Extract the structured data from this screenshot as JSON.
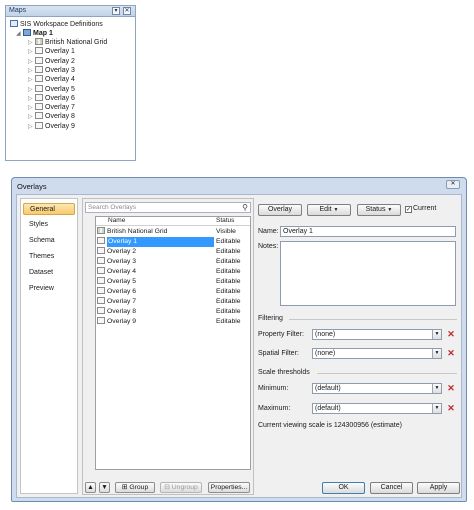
{
  "maps_panel": {
    "title": "Maps",
    "pin_glyph": "▾",
    "close_glyph": "✕",
    "root_label": "SIS Workspace Definitions",
    "map_label": "Map 1",
    "items": [
      {
        "label": "British National Grid",
        "icon": "grid-icon"
      },
      {
        "label": "Overlay 1",
        "icon": "overlay-icon"
      },
      {
        "label": "Overlay 2",
        "icon": "overlay-icon"
      },
      {
        "label": "Overlay 3",
        "icon": "overlay-icon"
      },
      {
        "label": "Overlay 4",
        "icon": "overlay-icon"
      },
      {
        "label": "Overlay 5",
        "icon": "overlay-icon"
      },
      {
        "label": "Overlay 6",
        "icon": "overlay-icon"
      },
      {
        "label": "Overlay 7",
        "icon": "overlay-icon"
      },
      {
        "label": "Overlay 8",
        "icon": "overlay-icon"
      },
      {
        "label": "Overlay 9",
        "icon": "overlay-icon"
      }
    ]
  },
  "dialog": {
    "title": "Overlays",
    "close_glyph": "✕",
    "nav": [
      "General",
      "Styles",
      "Schema",
      "Themes",
      "Dataset",
      "Preview"
    ],
    "nav_selected": "General",
    "search_placeholder": "Search Overlays",
    "search_icon": "🔍",
    "columns": {
      "name": "Name",
      "status": "Status"
    },
    "rows": [
      {
        "name": "British National Grid",
        "status": "Visible"
      },
      {
        "name": "Overlay 1",
        "status": "Editable"
      },
      {
        "name": "Overlay 2",
        "status": "Editable"
      },
      {
        "name": "Overlay 3",
        "status": "Editable"
      },
      {
        "name": "Overlay 4",
        "status": "Editable"
      },
      {
        "name": "Overlay 5",
        "status": "Editable"
      },
      {
        "name": "Overlay 6",
        "status": "Editable"
      },
      {
        "name": "Overlay 7",
        "status": "Editable"
      },
      {
        "name": "Overlay 8",
        "status": "Editable"
      },
      {
        "name": "Overlay 9",
        "status": "Editable"
      }
    ],
    "selected_row": "Overlay 1",
    "list_buttons": {
      "up": "▲",
      "down": "▼",
      "group": "Group",
      "ungroup": "Ungroup",
      "properties": "Properties..."
    },
    "toolbar": {
      "overlay": "Overlay",
      "edit": "Edit",
      "status": "Status",
      "current": "Current",
      "current_checked": "✓",
      "arrow": "▼"
    },
    "name_label": "Name:",
    "name_value": "Overlay 1",
    "notes_label": "Notes:",
    "filtering_label": "Filtering",
    "property_filter_label": "Property Filter:",
    "property_filter_value": "(none)",
    "spatial_filter_label": "Spatial Filter:",
    "spatial_filter_value": "(none)",
    "scale_label": "Scale thresholds",
    "minimum_label": "Minimum:",
    "minimum_value": "(default)",
    "maximum_label": "Maximum:",
    "maximum_value": "(default)",
    "scale_text": "Current viewing scale is 124300956 (estimate)",
    "clear_glyph": "✕",
    "ok": "OK",
    "cancel": "Cancel",
    "apply": "Apply"
  }
}
